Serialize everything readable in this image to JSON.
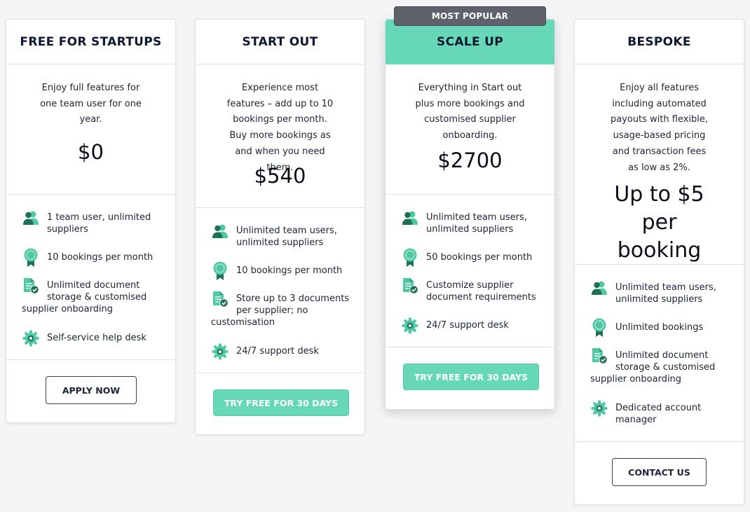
{
  "badge": "MOST POPULAR",
  "colors": {
    "accent": "#66d8b7",
    "badge_bg": "#5f626b",
    "icon": "#4fc9a4",
    "icon_dark": "#1f6f57",
    "background": "#f4f5f7"
  },
  "plans": [
    {
      "title": "FREE FOR STARTUPS",
      "description": "Enjoy full features for one team user for one year.",
      "price": "$0",
      "features": [
        {
          "icon": "users-icon",
          "text": "1 team user, unlimited suppliers"
        },
        {
          "icon": "award-icon",
          "text": "10 bookings per month"
        },
        {
          "icon": "document-check-icon",
          "text": "Unlimited document storage & customised supplier onboarding"
        },
        {
          "icon": "gear-icon",
          "text": "Self-service help desk"
        }
      ],
      "button": "APPLY NOW"
    },
    {
      "title": "START OUT",
      "description": "Experience most features – add up to 10 bookings per month. Buy more bookings as and when you need them.",
      "price": "$540",
      "features": [
        {
          "icon": "users-icon",
          "text": "Unlimited team users, unlimited suppliers"
        },
        {
          "icon": "award-icon",
          "text": "10 bookings per month"
        },
        {
          "icon": "document-check-icon",
          "text": "Store up to 3 documents per supplier; no customisation"
        },
        {
          "icon": "gear-icon",
          "text": "24/7 support desk"
        }
      ],
      "button": "TRY FREE FOR 30 DAYS"
    },
    {
      "title": "SCALE UP",
      "description": "Everything in Start out plus more bookings and customised supplier onboarding.",
      "price": "$2700",
      "features": [
        {
          "icon": "users-icon",
          "text": "Unlimited team users, unlimited suppliers"
        },
        {
          "icon": "award-icon",
          "text": "50 bookings per month"
        },
        {
          "icon": "document-check-icon",
          "text": "Customize supplier document requirements"
        },
        {
          "icon": "gear-icon",
          "text": "24/7 support desk"
        }
      ],
      "button": "TRY FREE FOR 30 DAYS"
    },
    {
      "title": "BESPOKE",
      "description": "Enjoy all features including automated payouts with flexible, usage-based pricing and transaction fees as low as 2%.",
      "price": "Up to $5 per booking",
      "features": [
        {
          "icon": "users-icon",
          "text": "Unlimited team users, unlimited suppliers"
        },
        {
          "icon": "award-icon",
          "text": "Unlimited bookings"
        },
        {
          "icon": "document-check-icon",
          "text": "Unlimited document storage & customised supplier onboarding"
        },
        {
          "icon": "gear-icon",
          "text": "Dedicated account manager"
        }
      ],
      "button": "CONTACT US"
    }
  ]
}
